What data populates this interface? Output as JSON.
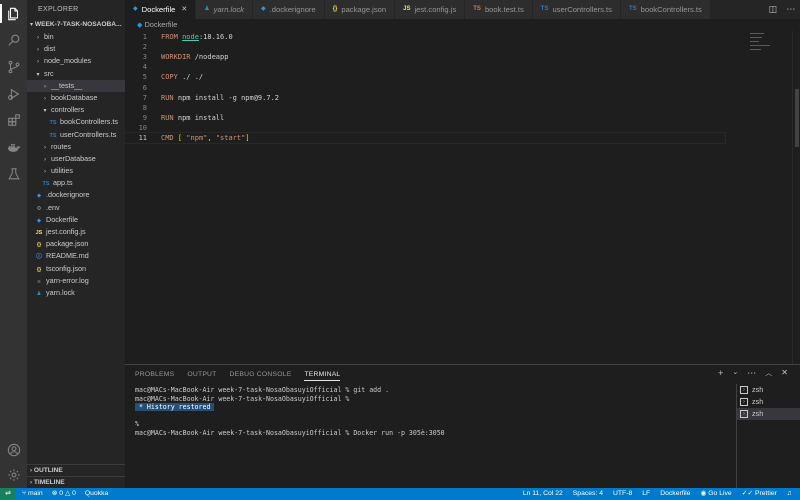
{
  "sidebar": {
    "header": "EXPLORER",
    "folder": "WEEK-7-TASK-NOSAOBA...",
    "items": [
      {
        "label": "bin",
        "indent": 1,
        "type": "folder-closed"
      },
      {
        "label": "dist",
        "indent": 1,
        "type": "folder-closed"
      },
      {
        "label": "node_modules",
        "indent": 1,
        "type": "folder-closed"
      },
      {
        "label": "src",
        "indent": 1,
        "type": "folder-open"
      },
      {
        "label": "__tests__",
        "indent": 2,
        "type": "folder-closed"
      },
      {
        "label": "bookDatabase",
        "indent": 2,
        "type": "folder-closed"
      },
      {
        "label": "controllers",
        "indent": 2,
        "type": "folder-open"
      },
      {
        "label": "bookControllers.ts",
        "indent": 3,
        "type": "ts"
      },
      {
        "label": "userControllers.ts",
        "indent": 3,
        "type": "ts"
      },
      {
        "label": "routes",
        "indent": 2,
        "type": "folder-closed"
      },
      {
        "label": "userDatabase",
        "indent": 2,
        "type": "folder-closed"
      },
      {
        "label": "utilities",
        "indent": 2,
        "type": "folder-closed"
      },
      {
        "label": "app.ts",
        "indent": 2,
        "type": "ts"
      },
      {
        "label": ".dockerignore",
        "indent": 1,
        "type": "docker"
      },
      {
        "label": ".env",
        "indent": 1,
        "type": "gear"
      },
      {
        "label": "Dockerfile",
        "indent": 1,
        "type": "docker"
      },
      {
        "label": "jest.config.js",
        "indent": 1,
        "type": "js"
      },
      {
        "label": "package.json",
        "indent": 1,
        "type": "json"
      },
      {
        "label": "README.md",
        "indent": 1,
        "type": "info"
      },
      {
        "label": "tsconfig.json",
        "indent": 1,
        "type": "json"
      },
      {
        "label": "yarn-error.log",
        "indent": 1,
        "type": "log"
      },
      {
        "label": "yarn.lock",
        "indent": 1,
        "type": "yarn"
      }
    ],
    "outline": "OUTLINE",
    "timeline": "TIMELINE"
  },
  "tabs": [
    {
      "label": "Dockerfile",
      "icon": "docker",
      "active": true
    },
    {
      "label": "yarn.lock",
      "icon": "yarn",
      "active": false
    },
    {
      "label": ".dockerignore",
      "icon": "docker",
      "active": false
    },
    {
      "label": "package.json",
      "icon": "json",
      "active": false
    },
    {
      "label": "jest.config.js",
      "icon": "js",
      "active": false
    },
    {
      "label": "book.test.ts",
      "icon": "test",
      "active": false
    },
    {
      "label": "userControllers.ts",
      "icon": "ts",
      "active": false
    },
    {
      "label": "bookControllers.ts",
      "icon": "ts",
      "active": false
    }
  ],
  "breadcrumb": "Dockerfile",
  "editor": {
    "lines": [
      {
        "n": "1",
        "tokens": [
          [
            "FROM ",
            "kw"
          ],
          [
            "node",
            "k-cyan-u"
          ],
          [
            ":18.16.0",
            "plain"
          ]
        ]
      },
      {
        "n": "2",
        "tokens": []
      },
      {
        "n": "3",
        "tokens": [
          [
            "WORKDIR ",
            "kw"
          ],
          [
            "/nodeapp",
            "plain"
          ]
        ]
      },
      {
        "n": "4",
        "tokens": []
      },
      {
        "n": "5",
        "tokens": [
          [
            "COPY ",
            "kw"
          ],
          [
            "./ ./",
            "plain"
          ]
        ]
      },
      {
        "n": "6",
        "tokens": []
      },
      {
        "n": "7",
        "tokens": [
          [
            "RUN ",
            "kw"
          ],
          [
            "npm install -g npm@9.7.2",
            "plain"
          ]
        ]
      },
      {
        "n": "8",
        "tokens": []
      },
      {
        "n": "9",
        "tokens": [
          [
            "RUN ",
            "kw"
          ],
          [
            "npm install",
            "plain"
          ]
        ]
      },
      {
        "n": "10",
        "tokens": []
      },
      {
        "n": "11",
        "tokens": [
          [
            "CMD ",
            "kw"
          ],
          [
            "[ ",
            "k-yellow"
          ],
          [
            "\"npm\"",
            "k-str"
          ],
          [
            ", ",
            "plain"
          ],
          [
            "\"start\"",
            "k-str"
          ],
          [
            "]",
            "k-yellow"
          ]
        ]
      }
    ],
    "current_line": "11"
  },
  "panel": {
    "tabs": [
      "PROBLEMS",
      "OUTPUT",
      "DEBUG CONSOLE",
      "TERMINAL"
    ],
    "active_tab": "TERMINAL",
    "terminal_lines": [
      {
        "text": "mac@MACs-MacBook-Air week-7-task-NosaObasuyiOfficial % git add .",
        "highlight": false
      },
      {
        "text": "mac@MACs-MacBook-Air week-7-task-NosaObasuyiOfficial %",
        "highlight": false
      },
      {
        "text": " * History restored ",
        "highlight": true
      },
      {
        "text": "",
        "highlight": false
      },
      {
        "text": "%",
        "highlight": false
      },
      {
        "text": "mac@MACs-MacBook-Air week-7-task-NosaObasuyiOfficial % Docker run -p 305è:3050",
        "highlight": false
      }
    ],
    "terminals": [
      {
        "label": "zsh",
        "selected": false
      },
      {
        "label": "zsh",
        "selected": false
      },
      {
        "label": "zsh",
        "selected": true
      }
    ]
  },
  "status": {
    "branch": "main",
    "errors": "0",
    "warnings": "0",
    "extension": "Quokka",
    "position": "Ln 11, Col 22",
    "spaces": "Spaces: 4",
    "encoding": "UTF-8",
    "eol": "LF",
    "language": "Dockerfile",
    "golive": "Go Live",
    "prettier": "Prettier"
  },
  "colors": {
    "accent": "#007acc",
    "remote": "#16825d",
    "keyword": "#ce9178",
    "ts_icon": "#3178c6",
    "docker_icon": "#2496ed",
    "js_icon": "#f1e05a"
  }
}
